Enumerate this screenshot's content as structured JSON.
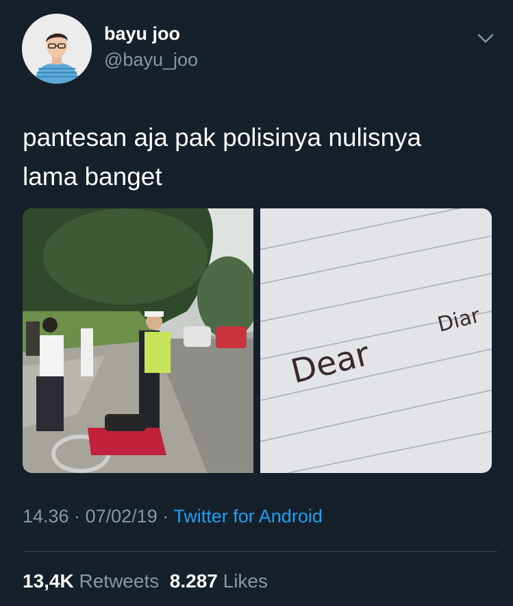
{
  "user": {
    "display_name": "bayu joo",
    "handle": "@bayu_joo"
  },
  "tweet": {
    "text_lines": [
      "pantesan aja pak polisinya nulisnya",
      "lama banget"
    ],
    "time": "14.36",
    "date": "07/02/19",
    "separator": "·",
    "source": "Twitter for Android"
  },
  "media": {
    "handwriting_main": "Dear",
    "handwriting_edge": "Diar"
  },
  "stats": {
    "retweets_count": "13,4K",
    "retweets_label": "Retweets",
    "likes_count": "8.287",
    "likes_label": "Likes"
  },
  "colors": {
    "background": "#15202b",
    "secondary_text": "#8899a6",
    "link": "#1da1f2",
    "divider": "#38444d"
  },
  "icons": [
    "chevron-down-icon"
  ]
}
